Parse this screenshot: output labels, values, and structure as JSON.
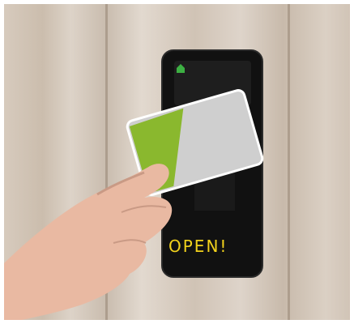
{
  "status": {
    "text": "OPEN!"
  },
  "colors": {
    "card_stripe": "#8ab82e",
    "card_body": "#cfcfcf",
    "reader": "#111111",
    "status_text": "#f2d21c"
  }
}
